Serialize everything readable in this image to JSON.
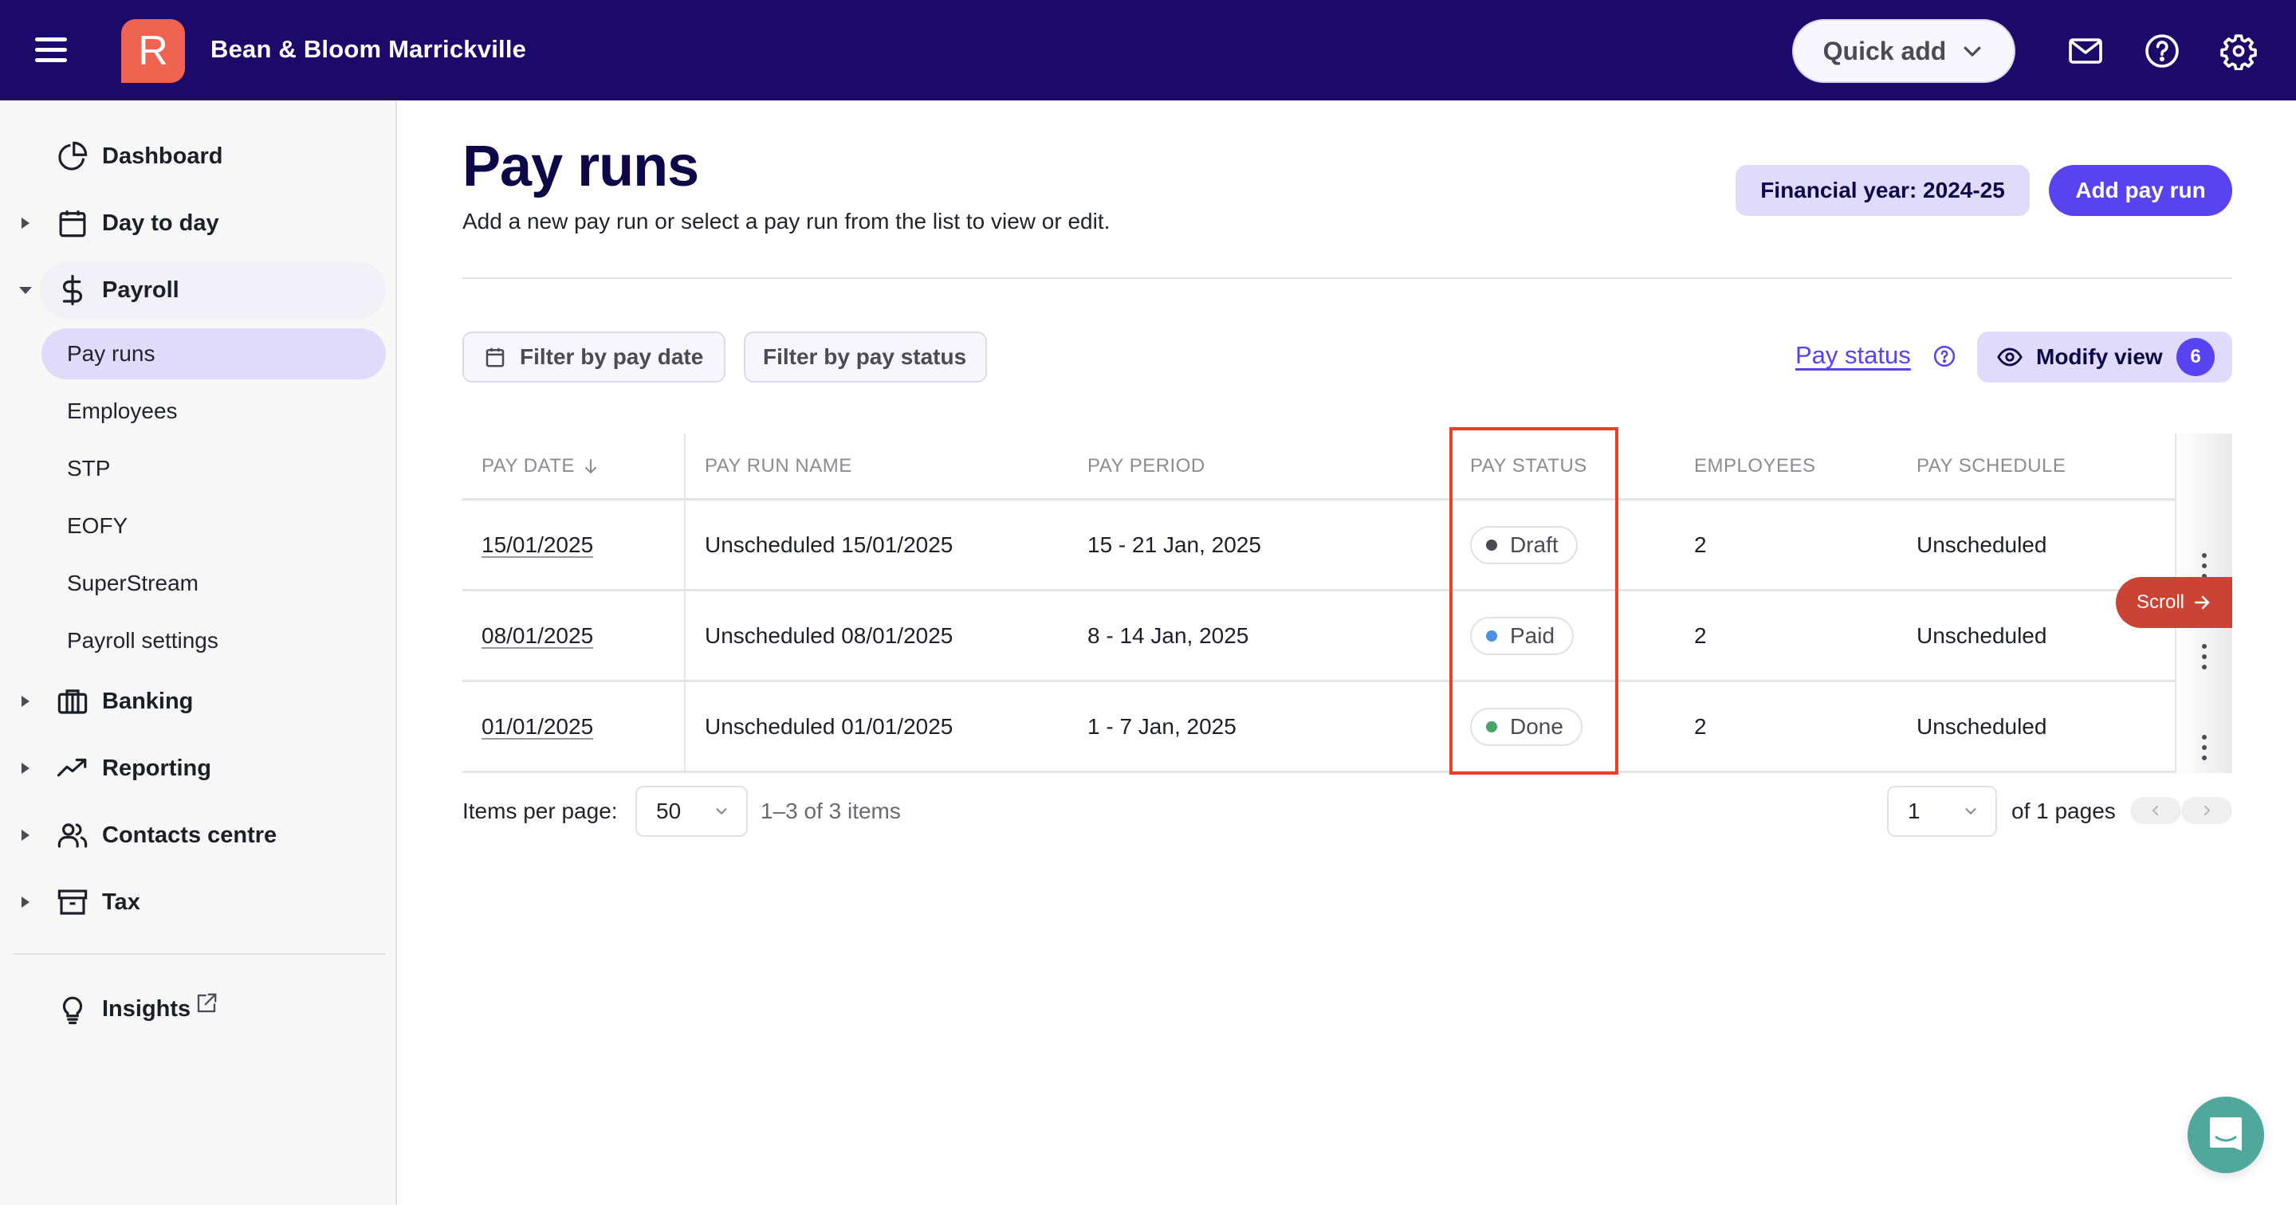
{
  "topbar": {
    "org_name": "Bean & Bloom Marrickville",
    "logo_letter": "R",
    "quick_add_label": "Quick add",
    "icons": [
      "menu-icon",
      "mail-icon",
      "help-icon",
      "settings-icon"
    ]
  },
  "sidebar": {
    "items": [
      {
        "label": "Dashboard",
        "icon": "pie-chart-icon",
        "expandable": false
      },
      {
        "label": "Day to day",
        "icon": "calendar-icon",
        "expandable": true,
        "expanded": false
      },
      {
        "label": "Payroll",
        "icon": "dollar-icon",
        "expandable": true,
        "expanded": true
      },
      {
        "label": "Banking",
        "icon": "bank-icon",
        "expandable": true,
        "expanded": false
      },
      {
        "label": "Reporting",
        "icon": "trend-icon",
        "expandable": true,
        "expanded": false
      },
      {
        "label": "Contacts centre",
        "icon": "users-icon",
        "expandable": true,
        "expanded": false
      },
      {
        "label": "Tax",
        "icon": "archive-icon",
        "expandable": true,
        "expanded": false
      }
    ],
    "payroll_sub_items": [
      {
        "label": "Pay runs",
        "active": true
      },
      {
        "label": "Employees",
        "active": false
      },
      {
        "label": "STP",
        "active": false
      },
      {
        "label": "EOFY",
        "active": false
      },
      {
        "label": "SuperStream",
        "active": false
      },
      {
        "label": "Payroll settings",
        "active": false
      }
    ],
    "insights": {
      "label": "Insights",
      "icon": "lightbulb-icon",
      "external": true
    }
  },
  "page": {
    "title": "Pay runs",
    "subtitle": "Add a new pay run or select a pay run from the list to view or edit.",
    "financial_year_label": "Financial year: 2024-25",
    "add_button_label": "Add pay run"
  },
  "toolbar": {
    "filter_date_label": "Filter by pay date",
    "filter_status_label": "Filter by pay status",
    "pay_status_link": "Pay status",
    "modify_view_label": "Modify view",
    "modify_view_count": "6"
  },
  "table": {
    "columns": [
      "PAY DATE",
      "PAY RUN NAME",
      "PAY PERIOD",
      "PAY STATUS",
      "EMPLOYEES",
      "PAY SCHEDULE"
    ],
    "sort_column": "PAY DATE",
    "sort_direction": "descending",
    "rows": [
      {
        "pay_date": "15/01/2025",
        "name": "Unscheduled 15/01/2025",
        "period": "15 - 21 Jan, 2025",
        "status": "Draft",
        "status_color": "#4c4a55",
        "employees": "2",
        "schedule": "Unscheduled"
      },
      {
        "pay_date": "08/01/2025",
        "name": "Unscheduled 08/01/2025",
        "period": "8 - 14 Jan, 2025",
        "status": "Paid",
        "status_color": "#4a90e2",
        "employees": "2",
        "schedule": "Unscheduled"
      },
      {
        "pay_date": "01/01/2025",
        "name": "Unscheduled 01/01/2025",
        "period": "1 - 7 Jan, 2025",
        "status": "Done",
        "status_color": "#4aa36a",
        "employees": "2",
        "schedule": "Unscheduled"
      }
    ],
    "scroll_hint_label": "Scroll"
  },
  "pagination": {
    "items_per_page_label": "Items per page:",
    "items_per_page_value": "50",
    "range_text": "1–3 of 3 items",
    "current_page": "1",
    "of_pages_text": "of 1 pages"
  },
  "colors": {
    "topbar": "#1c0a6b",
    "brand_logo": "#ef6351",
    "accent": "#5943f1",
    "accent_light": "#e0dbfa",
    "highlight": "#e8412b",
    "scroll_hint": "#cb4335",
    "chat": "#4fa89b"
  }
}
